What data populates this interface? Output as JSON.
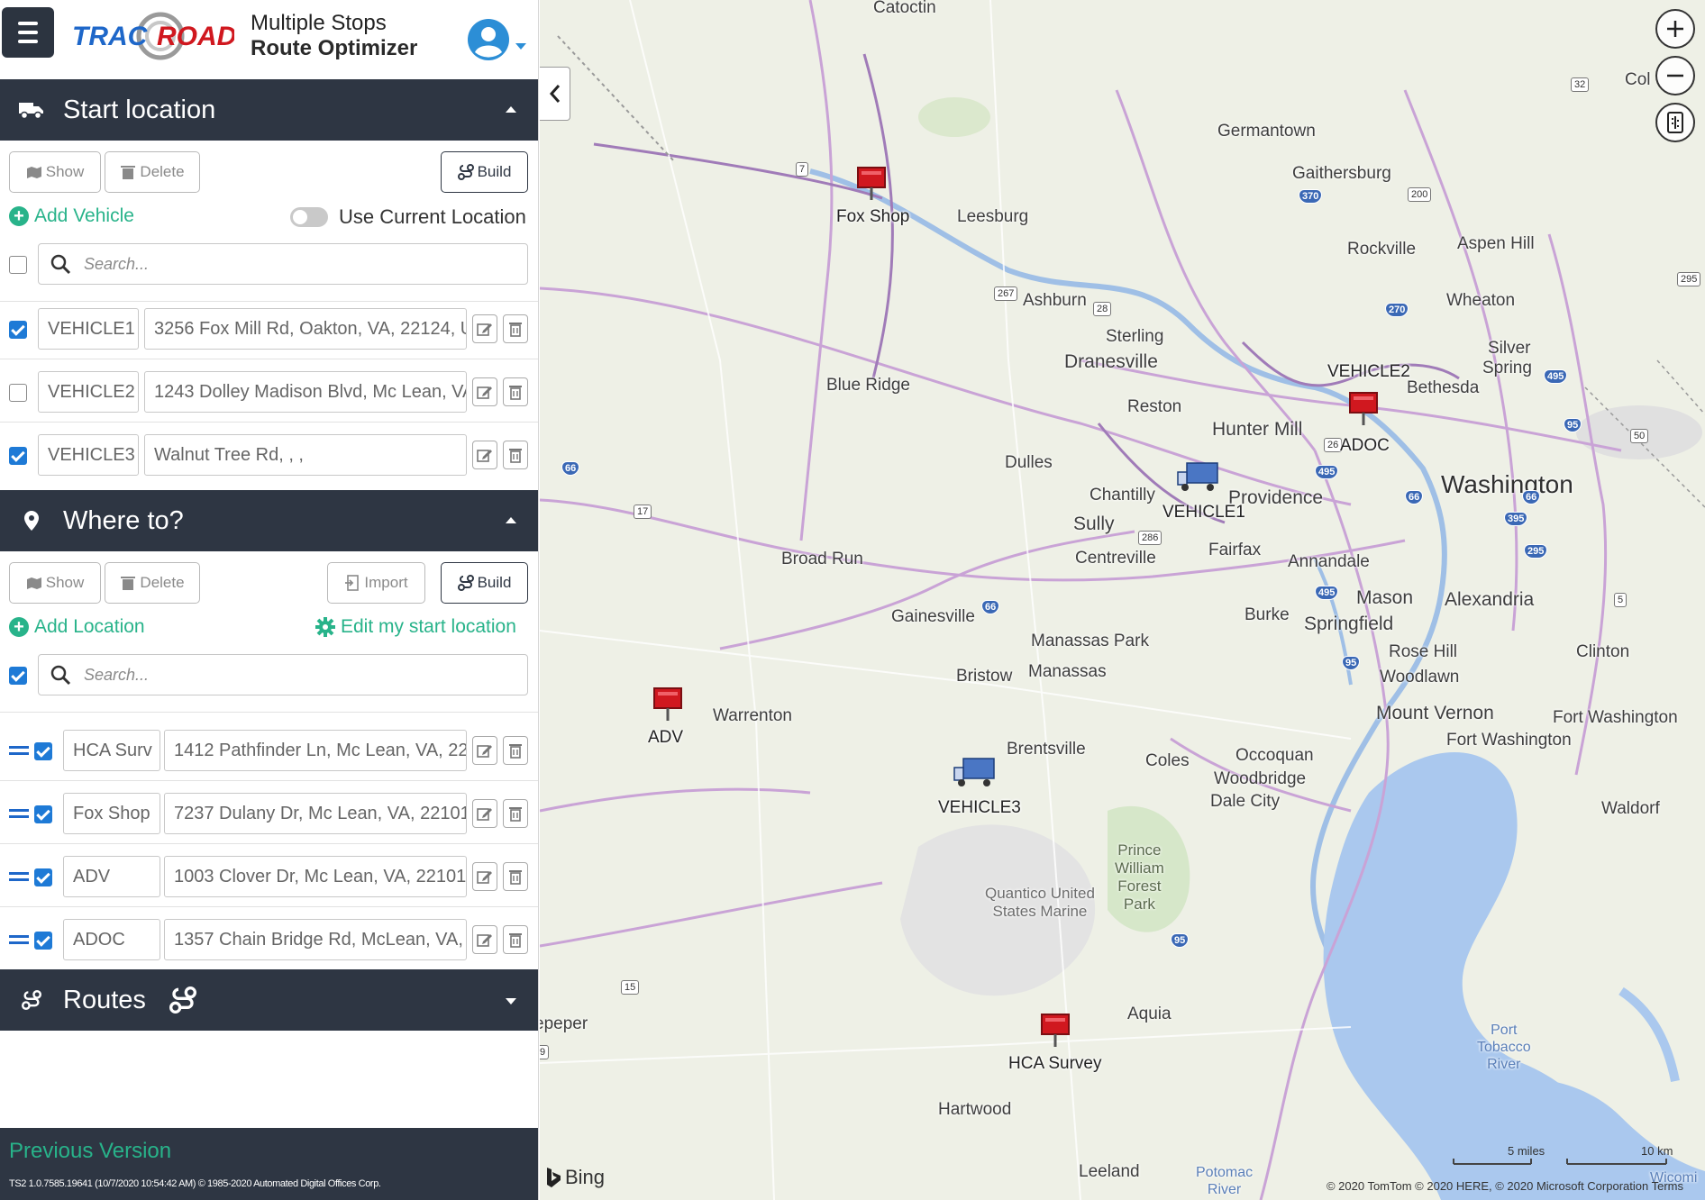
{
  "app": {
    "brand": "TRACKROAD",
    "title_line1": "Multiple Stops",
    "title_line2": "Route Optimizer"
  },
  "start_location": {
    "header": "Start location",
    "show_label": "Show",
    "delete_label": "Delete",
    "build_label": "Build",
    "add_vehicle_label": "Add Vehicle",
    "use_current_location_label": "Use Current Location",
    "search_placeholder": "Search...",
    "vehicles": [
      {
        "name": "VEHICLE1",
        "address": "3256 Fox Mill Rd, Oakton, VA, 22124, U",
        "checked": true
      },
      {
        "name": "VEHICLE2",
        "address": "1243 Dolley Madison Blvd, Mc Lean, VA",
        "checked": false
      },
      {
        "name": "VEHICLE3",
        "address": "Walnut Tree Rd, , ,",
        "checked": true
      }
    ]
  },
  "where_to": {
    "header": "Where to?",
    "show_label": "Show",
    "delete_label": "Delete",
    "import_label": "Import",
    "build_label": "Build",
    "add_location_label": "Add Location",
    "edit_start_label": "Edit my start location",
    "search_placeholder": "Search...",
    "locations": [
      {
        "name": "HCA Surv",
        "address": "1412 Pathfinder Ln, Mc Lean, VA, 22",
        "checked": true
      },
      {
        "name": "Fox Shop",
        "address": "7237 Dulany Dr, Mc Lean, VA, 22101",
        "checked": true
      },
      {
        "name": "ADV",
        "address": "1003 Clover Dr, Mc Lean, VA, 22101",
        "checked": true
      },
      {
        "name": "ADOC",
        "address": "1357 Chain Bridge Rd, McLean, VA, 2",
        "checked": true
      }
    ]
  },
  "routes": {
    "header": "Routes"
  },
  "footer": {
    "previous_version": "Previous Version",
    "build_info": "TS2 1.0.7585.19641 (10/7/2020 10:54:42 AM) © 1985-2020 Automated Digital Offices Corp."
  },
  "map": {
    "markers": {
      "fox_shop": "Fox Shop",
      "vehicle2": "VEHICLE2",
      "adoc": "ADOC",
      "vehicle1": "VEHICLE1",
      "adv": "ADV",
      "vehicle3": "VEHICLE3",
      "hca_survey": "HCA Survey"
    },
    "places": {
      "catoctin": "Catoctin",
      "germantown": "Germantown",
      "gaithersburg": "Gaithersburg",
      "leesburg": "Leesburg",
      "rockville": "Rockville",
      "aspen_hill": "Aspen Hill",
      "wheaton": "Wheaton",
      "ashburn": "Ashburn",
      "sterling": "Sterling",
      "dranesville": "Dranesville",
      "silver": "Silver",
      "spring": "Spring",
      "bethesda": "Bethesda",
      "blue_ridge": "Blue Ridge",
      "reston": "Reston",
      "hunter_mill": "Hunter Mill",
      "dulles": "Dulles",
      "washington": "Washington",
      "chantilly": "Chantilly",
      "providence": "Providence",
      "sully": "Sully",
      "fairfax": "Fairfax",
      "broad_run": "Broad Run",
      "centreville": "Centreville",
      "annandale": "Annandale",
      "mason": "Mason",
      "alexandria": "Alexandria",
      "burke": "Burke",
      "springfield": "Springfield",
      "gainesville": "Gainesville",
      "manassas_park": "Manassas Park",
      "manassas": "Manassas",
      "bristow": "Bristow",
      "rose_hill": "Rose Hill",
      "woodlawn": "Woodlawn",
      "clinton": "Clinton",
      "warrenton": "Warrenton",
      "mount_vernon": "Mount Vernon",
      "fort_washington_a": "Fort Washington",
      "fort_washington_b": "Fort Washington",
      "brentsville": "Brentsville",
      "coles": "Coles",
      "occoquan": "Occoquan",
      "woodbridge": "Woodbridge",
      "dale_city": "Dale City",
      "waldorf": "Waldorf",
      "pwfp_1": "Prince",
      "pwfp_2": "William",
      "pwfp_3": "Forest",
      "pwfp_4": "Park",
      "quantico_1": "Quantico United",
      "quantico_2": "States Marine",
      "aquia": "Aquia",
      "hartwood": "Hartwood",
      "leeland": "Leeland",
      "potomac_river_1": "Potomac",
      "potomac_river_2": "River",
      "port_tobacco_1": "Port",
      "port_tobacco_2": "Tobacco",
      "port_tobacco_3": "River",
      "peper": "epeper",
      "col": "Col",
      "wicomi": "Wicomi"
    },
    "shields": [
      "7",
      "370",
      "200",
      "267",
      "28",
      "270",
      "295",
      "495",
      "95",
      "50",
      "26",
      "495",
      "66",
      "395",
      "17",
      "286",
      "66",
      "66",
      "295",
      "5",
      "495",
      "95",
      "66",
      "95",
      "15",
      "32",
      "9"
    ],
    "scale_miles": "5 miles",
    "scale_km": "10 km",
    "bing_label": "Bing",
    "copyright": "© 2020 TomTom © 2020 HERE, © 2020 Microsoft Corporation  Terms"
  },
  "colors": {
    "header_bg": "#2e3643",
    "accent_green": "#28b38a",
    "checkbox_blue": "#1e7ad6",
    "marker_red": "#d0181f"
  }
}
